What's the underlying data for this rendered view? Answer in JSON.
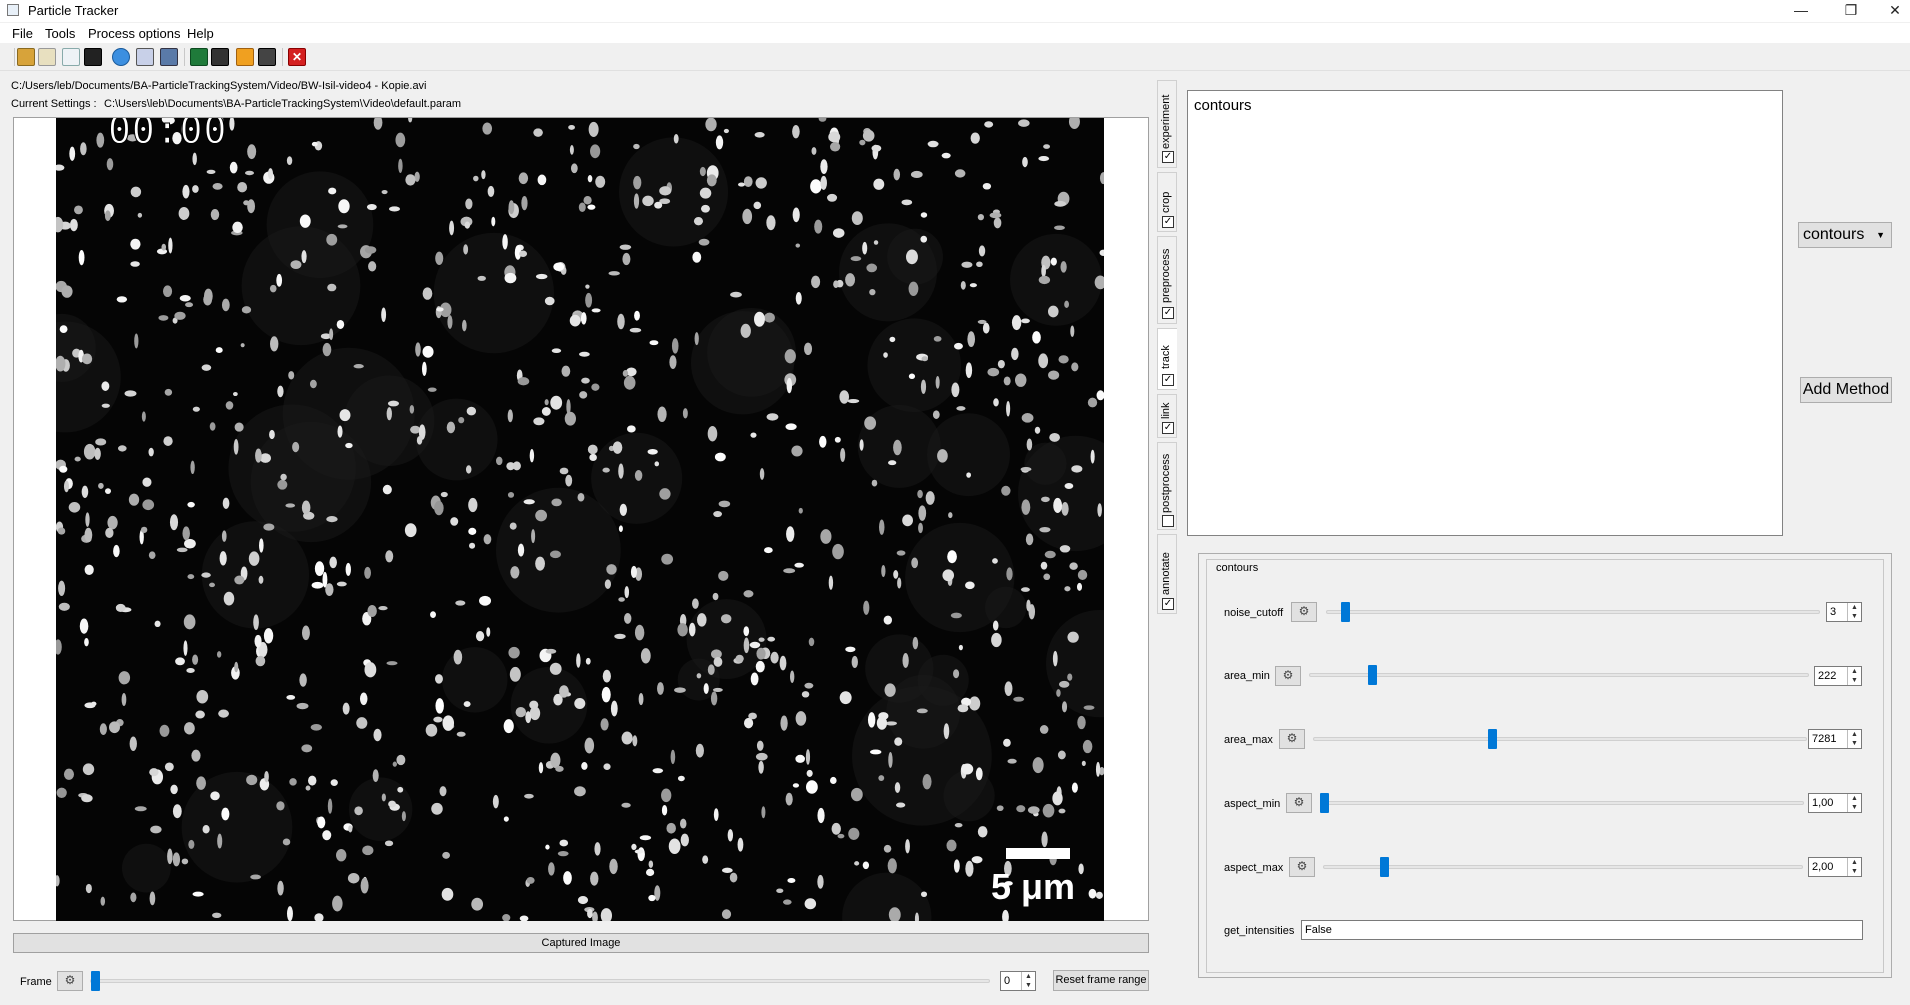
{
  "window": {
    "title": "Particle Tracker",
    "controls": {
      "minimize": "—",
      "restore": "❐",
      "close": "✕"
    }
  },
  "menu": [
    "File",
    "Tools",
    "Process options",
    "Help"
  ],
  "toolbar": {
    "icons": [
      "open-file-icon",
      "open-folder-icon",
      "load-settings-icon",
      "save-icon",
      "run-icon",
      "batch-run-icon",
      "camera-icon",
      "video-icon",
      "excel-export-icon",
      "film-strip-icon",
      "flash-icon",
      "clapper-icon",
      "exit-icon"
    ]
  },
  "file_path": "C:/Users/leb/Documents/BA-ParticleTrackingSystem/Video/BW-Isil-video4 - Kopie.avi",
  "settings": {
    "label": "Current Settings :",
    "path": "C:\\Users\\leb\\Documents\\BA-ParticleTrackingSystem\\Video\\default.param"
  },
  "video": {
    "timestamp": "00:00",
    "scale_label": "5 μm"
  },
  "captured_label": "Captured Image",
  "frame": {
    "label": "Frame",
    "value": "0",
    "reset_label": "Reset frame range",
    "level": 0
  },
  "tabs": [
    {
      "label": "experiment",
      "checked": true
    },
    {
      "label": "crop",
      "checked": true
    },
    {
      "label": "preprocess",
      "checked": true
    },
    {
      "label": "track",
      "checked": true,
      "active": true
    },
    {
      "label": "link",
      "checked": true
    },
    {
      "label": "postprocess",
      "checked": false
    },
    {
      "label": "annotate",
      "checked": true
    }
  ],
  "methods": {
    "items": [
      "contours"
    ],
    "selected": "contours",
    "add_label": "Add Method"
  },
  "params": {
    "group_title": "contours",
    "rows": [
      {
        "name": "noise_cutoff",
        "value": "3",
        "level": 0.03
      },
      {
        "name": "area_min",
        "value": "222",
        "level": 0.12
      },
      {
        "name": "area_max",
        "value": "7281",
        "level": 0.36
      },
      {
        "name": "aspect_min",
        "value": "1,00",
        "level": 0.0
      },
      {
        "name": "aspect_max",
        "value": "2,00",
        "level": 0.12
      }
    ],
    "intensities": {
      "name": "get_intensities",
      "value": "False"
    }
  },
  "colors": {
    "accent": "#0078d7",
    "video_background": "#050505",
    "particle": "#ffffff"
  }
}
